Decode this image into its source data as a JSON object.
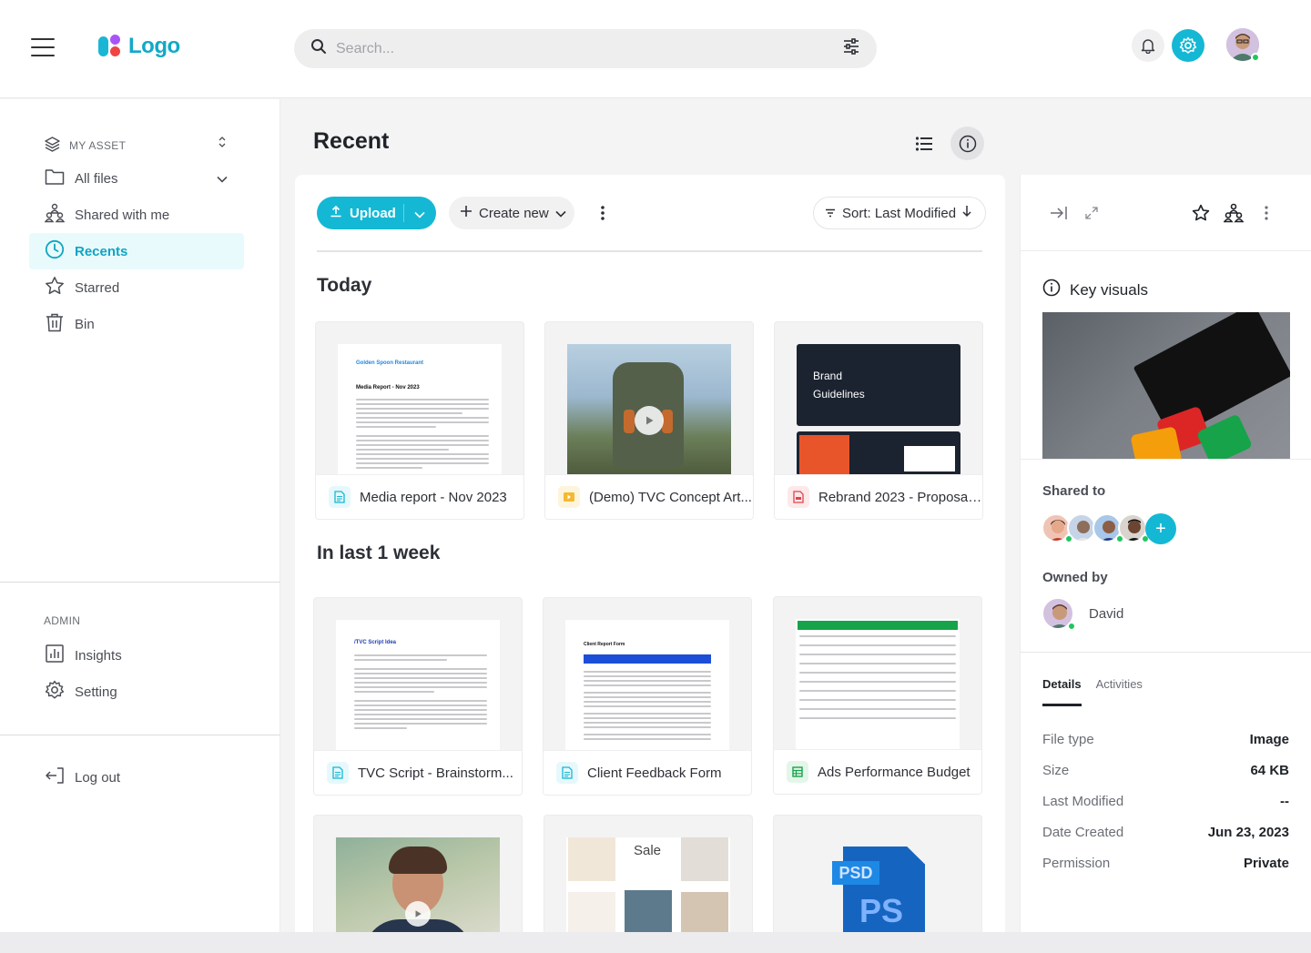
{
  "header": {
    "logo_text": "Logo",
    "search_placeholder": "Search...",
    "accent_color": "#14b8d4"
  },
  "sidebar": {
    "asset_section": "MY ASSET",
    "items": [
      {
        "label": "All files",
        "icon": "folder-icon"
      },
      {
        "label": "Shared with me",
        "icon": "people-icon"
      },
      {
        "label": "Recents",
        "icon": "clock-icon",
        "active": true
      },
      {
        "label": "Starred",
        "icon": "star-icon"
      },
      {
        "label": "Bin",
        "icon": "trash-icon"
      }
    ],
    "admin_section": "ADMIN",
    "admin_items": [
      {
        "label": "Insights",
        "icon": "chart-icon"
      },
      {
        "label": "Setting",
        "icon": "gear-icon"
      }
    ],
    "logout_label": "Log out"
  },
  "main": {
    "title": "Recent",
    "upload_label": "Upload",
    "create_label": "Create new",
    "sort_label": "Sort: Last Modified",
    "sections": [
      {
        "title": "Today",
        "files": [
          {
            "name": "Media report - Nov 2023",
            "type": "doc"
          },
          {
            "name": "(Demo) TVC Concept Art...",
            "type": "video"
          },
          {
            "name": "Rebrand 2023 - Proposal...",
            "type": "pdf"
          }
        ]
      },
      {
        "title": "In last 1 week",
        "files": [
          {
            "name": "TVC Script - Brainstorm...",
            "type": "doc"
          },
          {
            "name": "Client Feedback Form",
            "type": "doc"
          },
          {
            "name": "Ads Performance Budget",
            "type": "sheet"
          }
        ]
      }
    ],
    "thumb_text": {
      "restaurant": "Golden Spoon Restaurant",
      "report_title": "Media Report - Nov 2023",
      "brand": "Brand",
      "guidelines": "Guidelines",
      "script_title": "/TVC Script Idea",
      "form_title": "Client Report Form",
      "sale": "Sale",
      "psd": "PSD",
      "ps": "PS"
    }
  },
  "panel": {
    "title": "Key visuals",
    "shared_to_label": "Shared to",
    "owned_by_label": "Owned by",
    "owner_name": "David",
    "tabs": [
      "Details",
      "Activities"
    ],
    "details": [
      {
        "key": "File type",
        "value": "Image"
      },
      {
        "key": "Size",
        "value": "64 KB"
      },
      {
        "key": "Last Modified",
        "value": "--"
      },
      {
        "key": "Date Created",
        "value": "Jun 23, 2023"
      },
      {
        "key": "Permission",
        "value": "Private"
      }
    ]
  }
}
